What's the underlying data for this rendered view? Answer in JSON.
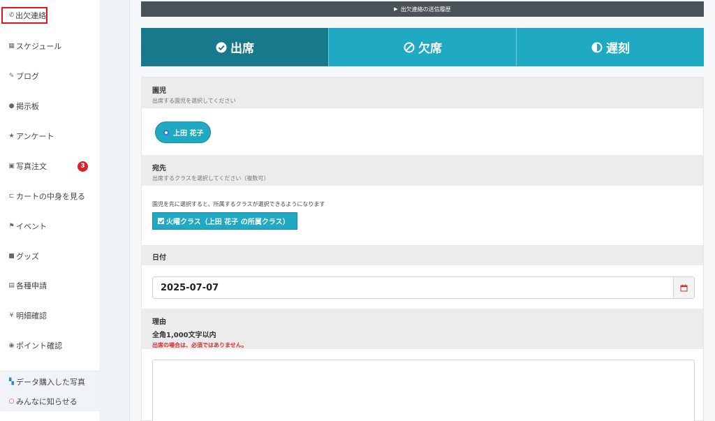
{
  "sidebar": {
    "items": [
      {
        "label": "出欠連絡",
        "icon": "phone-icon"
      },
      {
        "label": "スケジュール",
        "icon": "calendar-icon"
      },
      {
        "label": "ブログ",
        "icon": "pencil-icon"
      },
      {
        "label": "掲示板",
        "icon": "comment-icon"
      },
      {
        "label": "アンケート",
        "icon": "star-icon"
      },
      {
        "label": "写真注文",
        "icon": "image-icon",
        "badge": "3"
      },
      {
        "label": "カートの中身を見る",
        "icon": "cart-icon"
      },
      {
        "label": "イベント",
        "icon": "flag-icon"
      },
      {
        "label": "グッズ",
        "icon": "box-icon"
      },
      {
        "label": "各種申請",
        "icon": "document-icon"
      },
      {
        "label": "明細確認",
        "icon": "yen-icon"
      },
      {
        "label": "ポイント確認",
        "icon": "coin-icon"
      }
    ],
    "bottom": [
      {
        "label": "データ購入した写真",
        "icon": "grid-icon"
      },
      {
        "label": "みんなに知らせる",
        "icon": "speech-bubble-icon"
      }
    ]
  },
  "history_bar": {
    "label": "出欠連絡の送信履歴"
  },
  "tabs": [
    {
      "label": "出席",
      "icon": "check-circle-icon"
    },
    {
      "label": "欠席",
      "icon": "ban-icon"
    },
    {
      "label": "遅刻",
      "icon": "half-circle-icon"
    }
  ],
  "form": {
    "child": {
      "title": "園児",
      "subtitle": "出席する園児を選択してください",
      "selected": "上田 花子"
    },
    "dest": {
      "title": "宛先",
      "subtitle": "出席するクラスを選択してください（複数可）",
      "hint": "園児を先に選択すると、所属するクラスが選択できるようになります",
      "class_label": "火曜クラス（上田 花子 の所属クラス）"
    },
    "date": {
      "title": "日付",
      "value": "2025-07-07"
    },
    "reason": {
      "title": "理由",
      "limit": "全角1,000文字以内",
      "warning": "出席の場合は、必須ではありません。"
    }
  },
  "colors": {
    "primary": "#20a9c2",
    "primary_dark": "#177a8c",
    "badge": "#d9232a",
    "active_border": "#e4161c",
    "warning": "#d32f2f"
  }
}
